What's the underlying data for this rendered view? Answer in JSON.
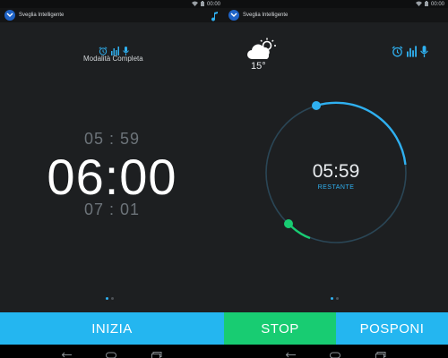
{
  "status": {
    "time": "00:00"
  },
  "app": {
    "title": "Sveglia Intelligente"
  },
  "left": {
    "mode_label": "Modalità Completa",
    "time_prev": "05 : 59",
    "time_main": "06:00",
    "time_next": "07 : 01",
    "start_label": "INIZIA"
  },
  "right": {
    "temperature": "15°",
    "remaining_time": "05:59",
    "remaining_label": "RESTANTE",
    "stop_label": "STOP",
    "snooze_label": "POSPONI"
  },
  "pager": {
    "pages": 2,
    "active": 0
  },
  "colors": {
    "accent": "#2fb0f0",
    "start_button": "#24b6f0",
    "stop_button": "#18cc72",
    "snooze_button": "#24b6f0",
    "background": "#1d1f21"
  },
  "icons": {
    "music": "music-note-icon",
    "alarm": "alarm-clock-icon",
    "sound_level": "sound-level-icon",
    "voice": "microphone-icon",
    "weather": "partly-cloudy-icon",
    "wifi": "wifi-icon",
    "battery": "battery-icon"
  }
}
